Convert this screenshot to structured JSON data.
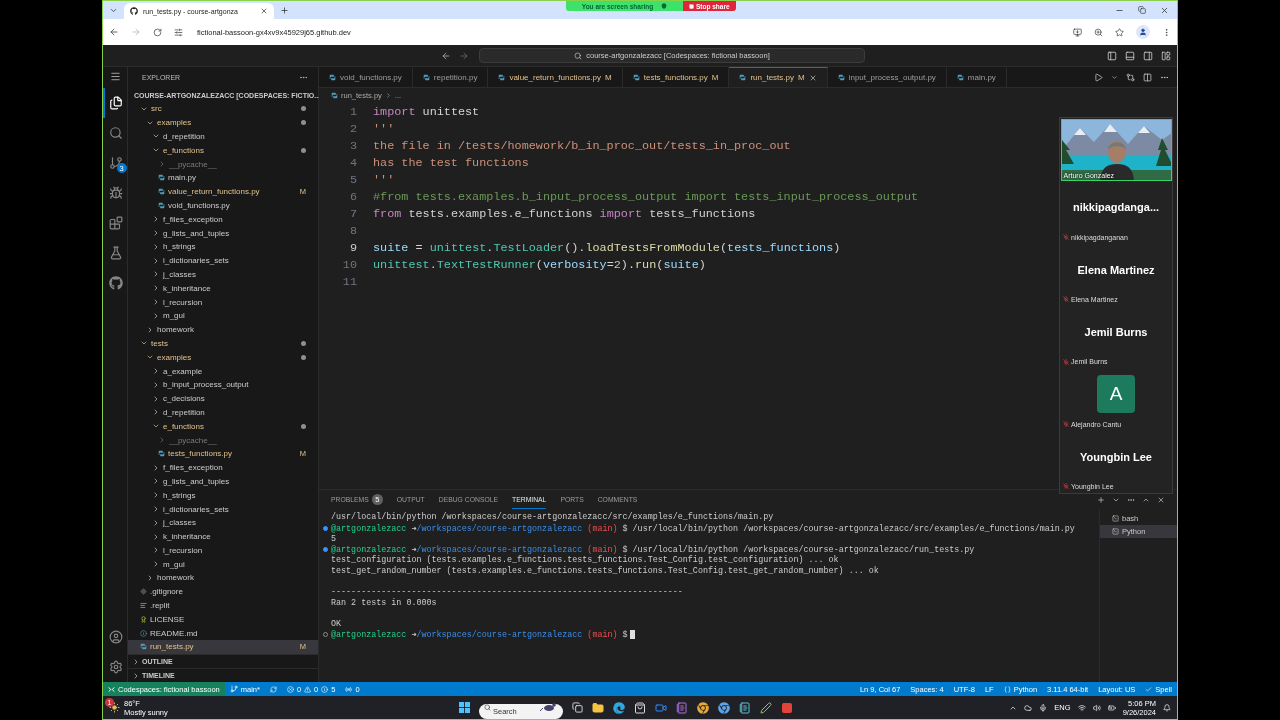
{
  "browser": {
    "tab_title": "run_tests.py - course-artgonza",
    "url": "fictional-bassoon-gx4xv9x45929j65.github.dev"
  },
  "share_banner": {
    "status": "You are screen sharing",
    "stop": "Stop share"
  },
  "vscode": {
    "command_center": "course-artgonzalezacc [Codespaces: fictional bassoon]",
    "activity": [
      {
        "kind": "explorer",
        "selected": true
      },
      {
        "kind": "search",
        "selected": false
      },
      {
        "kind": "source-control",
        "selected": false,
        "badge": "3"
      },
      {
        "kind": "run-debug",
        "selected": false
      },
      {
        "kind": "extensions",
        "selected": false
      },
      {
        "kind": "testing",
        "selected": false
      },
      {
        "kind": "github",
        "selected": false
      }
    ],
    "explorer": {
      "title": "EXPLORER",
      "workspace": "COURSE-ARTGONZALEZACC [CODESPACES: FICTIO...",
      "tree": [
        {
          "kind": "folder",
          "label": "src",
          "expanded": true,
          "modified": true,
          "selected": false,
          "children": [
            {
              "kind": "folder",
              "label": "examples",
              "expanded": true,
              "modified": true,
              "selected": false,
              "children": [
                {
                  "kind": "folder",
                  "label": "d_repetition",
                  "expanded": true,
                  "modified": false,
                  "selected": false
                },
                {
                  "kind": "folder",
                  "label": "e_functions",
                  "expanded": true,
                  "modified": true,
                  "selected": false,
                  "children": [
                    {
                      "kind": "ignored-folder",
                      "label": "__pycache__",
                      "expanded": false,
                      "modified": false,
                      "selected": false
                    },
                    {
                      "kind": "python",
                      "label": "main.py",
                      "modified": false,
                      "selected": false
                    },
                    {
                      "kind": "python",
                      "label": "value_return_functions.py",
                      "badge": "M",
                      "modified": true,
                      "selected": false
                    },
                    {
                      "kind": "python",
                      "label": "void_functions.py",
                      "modified": false,
                      "selected": false
                    }
                  ]
                },
                {
                  "kind": "folder",
                  "label": "f_files_exception",
                  "expanded": false,
                  "modified": false,
                  "selected": false
                },
                {
                  "kind": "folder",
                  "label": "g_lists_and_tuples",
                  "expanded": false,
                  "modified": false,
                  "selected": false
                },
                {
                  "kind": "folder",
                  "label": "h_strings",
                  "expanded": false,
                  "modified": false,
                  "selected": false
                },
                {
                  "kind": "folder",
                  "label": "i_dictionaries_sets",
                  "expanded": false,
                  "modified": false,
                  "selected": false
                },
                {
                  "kind": "folder",
                  "label": "j_classes",
                  "expanded": false,
                  "modified": false,
                  "selected": false
                },
                {
                  "kind": "folder",
                  "label": "k_inheritance",
                  "expanded": false,
                  "modified": false,
                  "selected": false
                },
                {
                  "kind": "folder",
                  "label": "l_recursion",
                  "expanded": false,
                  "modified": false,
                  "selected": false
                },
                {
                  "kind": "folder",
                  "label": "m_gui",
                  "expanded": false,
                  "modified": false,
                  "selected": false
                }
              ]
            },
            {
              "kind": "folder",
              "label": "homework",
              "expanded": false,
              "modified": false,
              "selected": false
            }
          ]
        },
        {
          "kind": "folder",
          "label": "tests",
          "expanded": true,
          "modified": true,
          "selected": false,
          "children": [
            {
              "kind": "folder",
              "label": "examples",
              "expanded": true,
              "modified": true,
              "selected": false,
              "children": [
                {
                  "kind": "folder",
                  "label": "a_example",
                  "expanded": false,
                  "modified": false,
                  "selected": false
                },
                {
                  "kind": "folder",
                  "label": "b_input_process_output",
                  "expanded": false,
                  "modified": false,
                  "selected": false
                },
                {
                  "kind": "folder",
                  "label": "c_decisions",
                  "expanded": false,
                  "modified": false,
                  "selected": false
                },
                {
                  "kind": "folder",
                  "label": "d_repetition",
                  "expanded": false,
                  "modified": false,
                  "selected": false
                },
                {
                  "kind": "folder",
                  "label": "e_functions",
                  "expanded": true,
                  "modified": true,
                  "selected": false,
                  "children": [
                    {
                      "kind": "ignored-folder",
                      "label": "__pycache__",
                      "expanded": false,
                      "modified": false,
                      "selected": false
                    },
                    {
                      "kind": "python",
                      "label": "tests_functions.py",
                      "badge": "M",
                      "modified": true,
                      "selected": false
                    }
                  ]
                },
                {
                  "kind": "folder",
                  "label": "f_files_exception",
                  "expanded": false,
                  "modified": false,
                  "selected": false
                },
                {
                  "kind": "folder",
                  "label": "g_lists_and_tuples",
                  "expanded": false,
                  "modified": false,
                  "selected": false
                },
                {
                  "kind": "folder",
                  "label": "h_strings",
                  "expanded": false,
                  "modified": false,
                  "selected": false
                },
                {
                  "kind": "folder",
                  "label": "i_dictionaries_sets",
                  "expanded": false,
                  "modified": false,
                  "selected": false
                },
                {
                  "kind": "folder",
                  "label": "j_classes",
                  "expanded": false,
                  "modified": false,
                  "selected": false
                },
                {
                  "kind": "folder",
                  "label": "k_inheritance",
                  "expanded": false,
                  "modified": false,
                  "selected": false
                },
                {
                  "kind": "folder",
                  "label": "l_recursion",
                  "expanded": false,
                  "modified": false,
                  "selected": false
                },
                {
                  "kind": "folder",
                  "label": "m_gui",
                  "expanded": false,
                  "modified": false,
                  "selected": false
                }
              ]
            },
            {
              "kind": "folder",
              "label": "homework",
              "expanded": false,
              "modified": false,
              "selected": false
            }
          ]
        },
        {
          "kind": "git",
          "label": ".gitignore",
          "modified": false,
          "selected": false
        },
        {
          "kind": "text",
          "label": ".replit",
          "modified": false,
          "selected": false
        },
        {
          "kind": "license",
          "label": "LICENSE",
          "modified": false,
          "selected": false
        },
        {
          "kind": "info",
          "label": "README.md",
          "modified": false,
          "selected": false
        },
        {
          "kind": "python",
          "label": "run_tests.py",
          "badge": "M",
          "modified": true,
          "selected": true
        }
      ],
      "sections": [
        {
          "label": "OUTLINE",
          "expanded": false
        },
        {
          "label": "TIMELINE",
          "expanded": false
        }
      ]
    },
    "tabs": [
      {
        "label": "void_functions.py",
        "modified": false,
        "selected": false
      },
      {
        "label": "repetition.py",
        "modified": false,
        "selected": false
      },
      {
        "label": "value_return_functions.py",
        "badge": "M",
        "modified": true,
        "selected": false
      },
      {
        "label": "tests_functions.py",
        "badge": "M",
        "modified": true,
        "selected": false
      },
      {
        "label": "run_tests.py",
        "badge": "M",
        "modified": true,
        "selected": true
      },
      {
        "label": "input_process_output.py",
        "modified": false,
        "selected": false
      },
      {
        "label": "main.py",
        "modified": false,
        "selected": false
      }
    ],
    "breadcrumb": [
      "run_tests.py",
      "..."
    ],
    "code": [
      {
        "number": "1",
        "tokens": [
          {
            "kind": "kw",
            "text": "import"
          },
          {
            "kind": "plain",
            "text": " unittest"
          }
        ]
      },
      {
        "number": "2",
        "tokens": [
          {
            "kind": "str",
            "text": "'''"
          }
        ]
      },
      {
        "number": "3",
        "tokens": [
          {
            "kind": "str",
            "text": "the file in /tests/homework/b_in_proc_out/tests_in_proc_out"
          }
        ]
      },
      {
        "number": "4",
        "tokens": [
          {
            "kind": "str",
            "text": "has the test functions"
          }
        ]
      },
      {
        "number": "5",
        "tokens": [
          {
            "kind": "str",
            "text": "'''"
          }
        ]
      },
      {
        "number": "6",
        "tokens": [
          {
            "kind": "comment",
            "text": "#from tests.examples.b_input_process_output import tests_input_process_output"
          }
        ]
      },
      {
        "number": "7",
        "tokens": [
          {
            "kind": "kw",
            "text": "from"
          },
          {
            "kind": "plain",
            "text": " tests.examples.e_functions "
          },
          {
            "kind": "kw",
            "text": "import"
          },
          {
            "kind": "plain",
            "text": " tests_functions"
          }
        ]
      },
      {
        "number": "8"
      },
      {
        "number": "9",
        "tokens": [
          {
            "kind": "var",
            "text": "suite"
          },
          {
            "kind": "plain",
            "text": " = "
          },
          {
            "kind": "cls",
            "text": "unittest"
          },
          {
            "kind": "plain",
            "text": "."
          },
          {
            "kind": "cls",
            "text": "TestLoader"
          },
          {
            "kind": "plain",
            "text": "()."
          },
          {
            "kind": "fn",
            "text": "loadTestsFromModule"
          },
          {
            "kind": "plain",
            "text": "("
          },
          {
            "kind": "var",
            "text": "tests_functions"
          },
          {
            "kind": "plain",
            "text": ")"
          }
        ]
      },
      {
        "number": "10",
        "tokens": [
          {
            "kind": "cls",
            "text": "unittest"
          },
          {
            "kind": "plain",
            "text": "."
          },
          {
            "kind": "cls",
            "text": "TextTestRunner"
          },
          {
            "kind": "plain",
            "text": "("
          },
          {
            "kind": "var",
            "text": "verbosity"
          },
          {
            "kind": "plain",
            "text": "="
          },
          {
            "kind": "num",
            "text": "2"
          },
          {
            "kind": "plain",
            "text": ")."
          },
          {
            "kind": "fn",
            "text": "run"
          },
          {
            "kind": "plain",
            "text": "("
          },
          {
            "kind": "var",
            "text": "suite"
          },
          {
            "kind": "plain",
            "text": ")"
          }
        ]
      },
      {
        "number": "11"
      }
    ],
    "panel": {
      "tabs": [
        {
          "label": "PROBLEMS",
          "count": "5",
          "selected": false
        },
        {
          "label": "OUTPUT",
          "selected": false
        },
        {
          "label": "DEBUG CONSOLE",
          "selected": false
        },
        {
          "label": "TERMINAL",
          "selected": true
        },
        {
          "label": "PORTS",
          "selected": false
        },
        {
          "label": "COMMENTS",
          "selected": false
        }
      ],
      "terminal": [
        {
          "kind": "output",
          "text": "/usr/local/bin/python /workspaces/course-artgonzalezacc/src/examples/e_functions/main.py"
        },
        {
          "kind": "prompt",
          "finished": true,
          "user": "@artgonzalezacc",
          "arrow": "➜",
          "path": "/workspaces/course-artgonzalezacc",
          "branch": "(main)",
          "command": "$ /usr/local/bin/python /workspaces/course-artgonzalezacc/src/examples/e_functions/main.py"
        },
        {
          "kind": "output",
          "text": "5"
        },
        {
          "kind": "prompt",
          "finished": true,
          "user": "@artgonzalezacc",
          "arrow": "➜",
          "path": "/workspaces/course-artgonzalezacc",
          "branch": "(main)",
          "command": "$ /usr/local/bin/python /workspaces/course-artgonzalezacc/run_tests.py"
        },
        {
          "kind": "output",
          "text": "test_configuration (tests.examples.e_functions.tests_functions.Test_Config.test_configuration) ... ok"
        },
        {
          "kind": "output",
          "text": "test_get_random_number (tests.examples.e_functions.tests_functions.Test_Config.test_get_random_number) ... ok"
        },
        {
          "kind": "blank"
        },
        {
          "kind": "output",
          "text": "----------------------------------------------------------------------"
        },
        {
          "kind": "output",
          "text": "Ran 2 tests in 0.000s"
        },
        {
          "kind": "blank"
        },
        {
          "kind": "output",
          "text": "OK"
        },
        {
          "kind": "prompt",
          "finished": false,
          "user": "@artgonzalezacc",
          "arrow": "➜",
          "path": "/workspaces/course-artgonzalezacc",
          "branch": "(main)",
          "command": "$"
        }
      ],
      "sessions": [
        {
          "label": "bash",
          "selected": false
        },
        {
          "label": "Python",
          "selected": true
        }
      ]
    },
    "status_bar": {
      "remote": "Codespaces: fictional bassoon",
      "branch": "main*",
      "errors": "0",
      "warnings": "0",
      "infos": "5",
      "ports": "0",
      "items": [
        {
          "kind": "text",
          "label": "Ln 9, Col 67"
        },
        {
          "kind": "text",
          "label": "Spaces: 4"
        },
        {
          "kind": "text",
          "label": "UTF-8"
        },
        {
          "kind": "text",
          "label": "LF"
        },
        {
          "kind": "language",
          "label": "Python"
        },
        {
          "kind": "text",
          "label": "3.11.4 64-bit"
        },
        {
          "kind": "text",
          "label": "Layout: US"
        },
        {
          "kind": "spell",
          "label": "Spell"
        }
      ]
    }
  },
  "meeting": {
    "self": {
      "name": "Arturo Gonzalez"
    },
    "participants": [
      {
        "kind": "name",
        "display": "nikkipagdanga...",
        "name": "nikkipagdanganan"
      },
      {
        "kind": "name",
        "display": "Elena Martinez",
        "name": "Elena Martinez"
      },
      {
        "kind": "name",
        "display": "Jemil Burns",
        "name": "Jemil Burns"
      },
      {
        "kind": "avatar",
        "initial": "A",
        "color": "#1e7a5c",
        "name": "Alejandro Cantu"
      },
      {
        "kind": "name",
        "display": "Youngbin Lee",
        "name": "Youngbin Lee"
      }
    ]
  },
  "taskbar": {
    "weather": {
      "badge": "1",
      "temp": "86°F",
      "summary": "Mostly sunny"
    },
    "search": {
      "placeholder": "Search"
    },
    "language": "ENG",
    "time": "5:06 PM",
    "date": "9/26/2024"
  }
}
